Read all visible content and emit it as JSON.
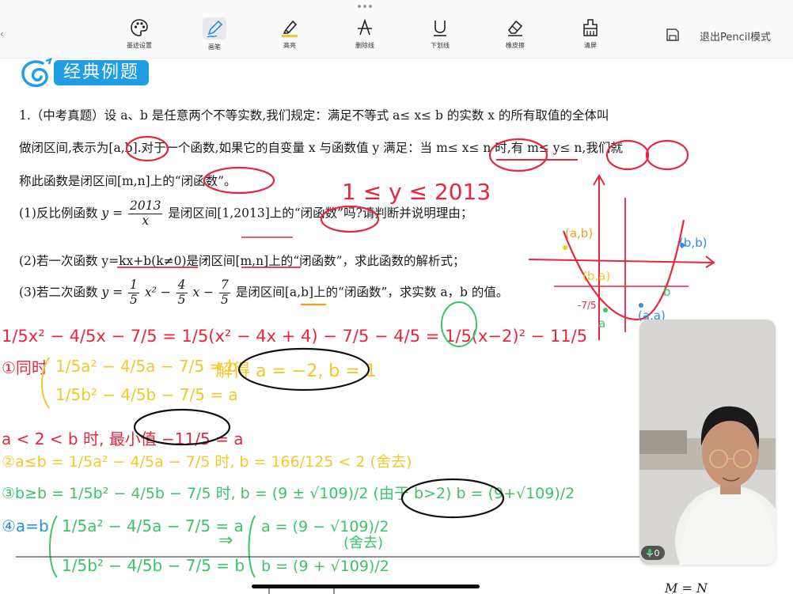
{
  "toolbar": {
    "tools": [
      {
        "label": "墨迹设置",
        "icon": "palette-icon"
      },
      {
        "label": "画笔",
        "icon": "pen-icon"
      },
      {
        "label": "高亮",
        "icon": "highlighter-icon"
      },
      {
        "label": "删除线",
        "icon": "strikethrough-icon"
      },
      {
        "label": "下划线",
        "icon": "underline-icon"
      },
      {
        "label": "橡皮擦",
        "icon": "eraser-icon"
      },
      {
        "label": "清屏",
        "icon": "clear-screen-icon"
      }
    ],
    "exit_label": "退出Pencil模式"
  },
  "document": {
    "section_title": "经典例题",
    "p1_line1": "1.（中考真题）设 a、b 是任意两个不等实数,我们规定：满足不等式 a≤ x≤ b 的实数 x 的所有取值的全体叫",
    "p1_line2": "做闭区间,表示为[a,b].对于一个函数,如果它的自变量 x 与函数值 y 满足：当 m≤ x≤ n 时,有 m≤ y≤ n,我们就",
    "p1_line3": "称此函数是闭区间[m,n]上的“闭函数”。",
    "q1_prefix": "(1)反比例函数",
    "q1_y": "y =",
    "q1_num": "2013",
    "q1_den": "x",
    "q1_suffix": "是闭区间[1,2013]上的“闭函数”吗?请判断并说明理由；",
    "q2": "(2)若一次函数 y=kx+b(k≠0)是闭区间[m,n]上的“闭函数”，求此函数的解析式；",
    "q3_prefix": "(3)若二次函数",
    "q3_y": "y =",
    "q3_f1n": "1",
    "q3_f1d": "5",
    "q3_x2": "x² −",
    "q3_f2n": "4",
    "q3_f2d": "5",
    "q3_x": "x −",
    "q3_f3n": "7",
    "q3_f3d": "5",
    "q3_suffix": "是闭区间[a,b]上的“闭函数”，求实数 a，b 的值。",
    "footer_formula": "M = N"
  },
  "handwriting": {
    "range_note": "1 ≤ y ≤ 2013",
    "label_ab": "(a,b)",
    "label_bb": "(b,b)",
    "label_ba": "(b,a)",
    "label_aa": "(a,a)",
    "label_b": "b",
    "label_a": "a",
    "label_minus7_5": "-7/5",
    "line1": "1/5x² − 4/5x − 7/5 = 1/5(x² − 4x + 4) − 7/5 − 4/5 = 1/5(x−2)² − 11/5",
    "line2_label": "①同时",
    "line2a": "1/5a² − 4/5a − 7/5 = b",
    "line2b": "1/5b² − 4/5b − 7/5 = a",
    "solution": "解得 a = −2, b = 1",
    "line3": "a < 2 < b 时, 最小值 −11/5 = a",
    "line4": "②a≤b = 1/5a² − 4/5a − 7/5 时, b = 166/125 < 2 (舍去)",
    "line5": "③b≥b = 1/5b² − 4/5b − 7/5 时, b = (9 ± √109)/2 (由于 b>2) b = (9+√109)/2",
    "line6_label": "④a=b",
    "line6a": "1/5a² − 4/5a − 7/5 = a",
    "line6b": "1/5b² − 4/5b − 7/5 = b",
    "line6_arrow": "⇒",
    "line6_result_a": "a = (9 − √109)/2",
    "line6_result_b": "b = (9 + √109)/2",
    "line6_note": "(舍去)"
  },
  "video": {
    "mic_count": "0"
  },
  "colors": {
    "red_ink": "#e8263f",
    "yellow_ink": "#f3c82b",
    "green_ink": "#3cc46a",
    "blue_ink": "#2d8ee6",
    "black_ink": "#111111",
    "badge_blue": "#1f9ee6"
  }
}
